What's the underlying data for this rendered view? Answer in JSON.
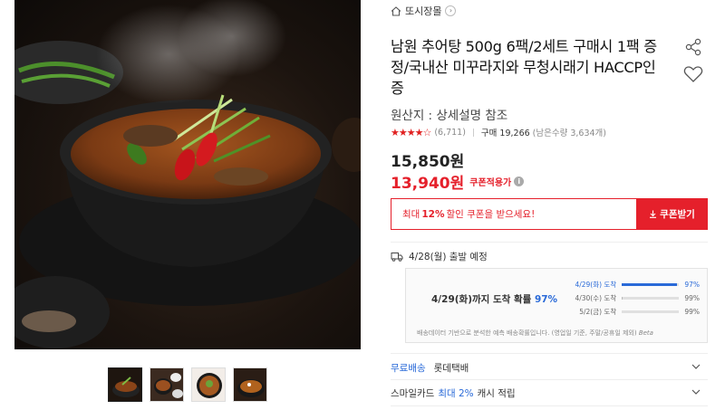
{
  "store": {
    "name": "또시장몰",
    "icon": "home-icon"
  },
  "product": {
    "title": "남원 추어탕 500g 6팩/2세트 구매시 1팩 증정/국내산 미꾸라지와 무청시래기 HACCP인증",
    "origin": "원산지 : 상세설명 참조",
    "rating": 4.5,
    "review_count": "(6,711)",
    "purchase_label": "구매 19,266",
    "remaining_label": "(남은수량 3,634개)",
    "original_price": "15,850원",
    "sale_price": "13,940원",
    "sale_label": "쿠폰적용가",
    "info_mark": "i"
  },
  "coupon": {
    "message_prefix": "최대",
    "message_pct": "12%",
    "message_suffix": "할인 쿠폰을 받으세요!",
    "button_label": "쿠폰받기",
    "button_icon": "download-icon"
  },
  "shipping": {
    "departure": "4/28(월) 출발 예정",
    "predict_main": "4/29(화)까지 도착 확률",
    "predict_pct": "97%",
    "predictions": [
      {
        "date": "4/29(화) 도착",
        "value": "97%",
        "fraction": 0.97
      },
      {
        "date": "4/30(수) 도착",
        "value": "99%",
        "fraction": 0.02
      },
      {
        "date": "5/2(금) 도착",
        "value": "99%",
        "fraction": 0.0
      }
    ],
    "note": "배송데이터 기반으로 분석한 예측 배송확률입니다. (영업일 기준, 주말/공휴일 제외)",
    "note_beta": "Beta"
  },
  "options": [
    {
      "blue": "무료배송",
      "text": "롯데택배"
    },
    {
      "prefix": "스마일카드",
      "blue": "최대 2%",
      "text": "캐시 적립"
    }
  ],
  "colors": {
    "accent_red": "#e5202b",
    "accent_blue": "#2a6ad8"
  }
}
